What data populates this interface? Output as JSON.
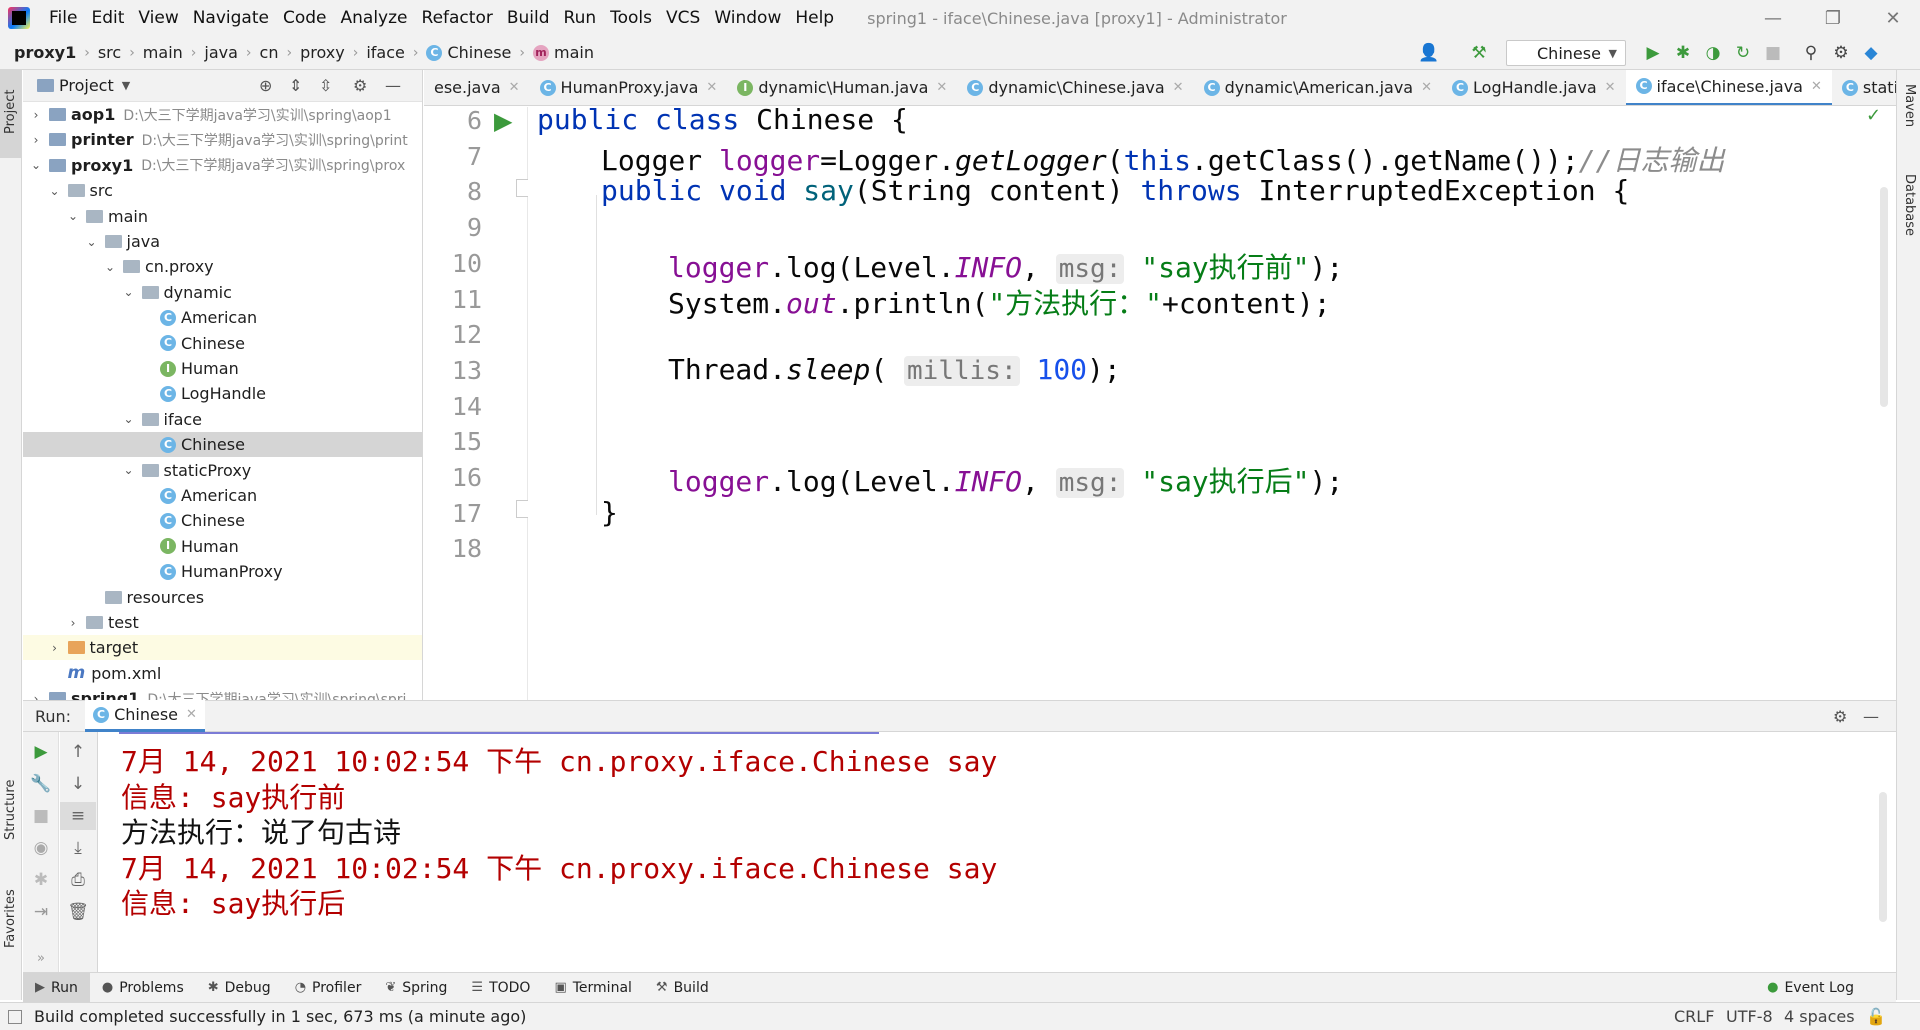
{
  "menu": {
    "items": [
      "File",
      "Edit",
      "View",
      "Navigate",
      "Code",
      "Analyze",
      "Refactor",
      "Build",
      "Run",
      "Tools",
      "VCS",
      "Window",
      "Help"
    ],
    "window_title": "spring1 - iface\\Chinese.java [proxy1] - Administrator"
  },
  "breadcrumb": [
    "proxy1",
    "src",
    "main",
    "java",
    "cn",
    "proxy",
    "iface",
    "Chinese",
    "main"
  ],
  "run_config": "Chinese",
  "project_panel": {
    "title": "Project",
    "tree": [
      {
        "label": "aop1",
        "path": "D:\\大三下学期java学习\\实训\\spring\\aop1",
        "level": 0,
        "bold": true,
        "arrow": "›",
        "icon": "module"
      },
      {
        "label": "printer",
        "path": "D:\\大三下学期java学习\\实训\\spring\\print",
        "level": 0,
        "bold": true,
        "arrow": "›",
        "icon": "module"
      },
      {
        "label": "proxy1",
        "path": "D:\\大三下学期java学习\\实训\\spring\\prox",
        "level": 0,
        "bold": true,
        "arrow": "⌄",
        "icon": "module"
      },
      {
        "label": "src",
        "path": "",
        "level": 1,
        "bold": false,
        "arrow": "⌄",
        "icon": "folder"
      },
      {
        "label": "main",
        "path": "",
        "level": 2,
        "bold": false,
        "arrow": "⌄",
        "icon": "folder"
      },
      {
        "label": "java",
        "path": "",
        "level": 3,
        "bold": false,
        "arrow": "⌄",
        "icon": "folder"
      },
      {
        "label": "cn.proxy",
        "path": "",
        "level": 4,
        "bold": false,
        "arrow": "⌄",
        "icon": "folder"
      },
      {
        "label": "dynamic",
        "path": "",
        "level": 5,
        "bold": false,
        "arrow": "⌄",
        "icon": "folder"
      },
      {
        "label": "American",
        "path": "",
        "level": 6,
        "bold": false,
        "arrow": "",
        "icon": "class"
      },
      {
        "label": "Chinese",
        "path": "",
        "level": 6,
        "bold": false,
        "arrow": "",
        "icon": "class"
      },
      {
        "label": "Human",
        "path": "",
        "level": 6,
        "bold": false,
        "arrow": "",
        "icon": "interface"
      },
      {
        "label": "LogHandle",
        "path": "",
        "level": 6,
        "bold": false,
        "arrow": "",
        "icon": "class"
      },
      {
        "label": "iface",
        "path": "",
        "level": 5,
        "bold": false,
        "arrow": "⌄",
        "icon": "folder"
      },
      {
        "label": "Chinese",
        "path": "",
        "level": 6,
        "bold": false,
        "arrow": "",
        "icon": "class",
        "selected": true
      },
      {
        "label": "staticProxy",
        "path": "",
        "level": 5,
        "bold": false,
        "arrow": "⌄",
        "icon": "folder"
      },
      {
        "label": "American",
        "path": "",
        "level": 6,
        "bold": false,
        "arrow": "",
        "icon": "class"
      },
      {
        "label": "Chinese",
        "path": "",
        "level": 6,
        "bold": false,
        "arrow": "",
        "icon": "class"
      },
      {
        "label": "Human",
        "path": "",
        "level": 6,
        "bold": false,
        "arrow": "",
        "icon": "interface"
      },
      {
        "label": "HumanProxy",
        "path": "",
        "level": 6,
        "bold": false,
        "arrow": "",
        "icon": "class"
      },
      {
        "label": "resources",
        "path": "",
        "level": 3,
        "bold": false,
        "arrow": "",
        "icon": "folder"
      },
      {
        "label": "test",
        "path": "",
        "level": 2,
        "bold": false,
        "arrow": "›",
        "icon": "folder"
      },
      {
        "label": "target",
        "path": "",
        "level": 1,
        "bold": false,
        "arrow": "›",
        "icon": "folder-orange"
      },
      {
        "label": "pom.xml",
        "path": "",
        "level": 1,
        "bold": false,
        "arrow": "",
        "icon": "maven"
      },
      {
        "label": "spring1",
        "path": "D:\\大三下学期java学习\\实训\\spring\\spri",
        "level": 0,
        "bold": true,
        "arrow": "›",
        "icon": "module"
      }
    ]
  },
  "tabs": [
    {
      "label": "ese.java",
      "icon": "none"
    },
    {
      "label": "HumanProxy.java",
      "icon": "class"
    },
    {
      "label": "dynamic\\Human.java",
      "icon": "interface"
    },
    {
      "label": "dynamic\\Chinese.java",
      "icon": "class"
    },
    {
      "label": "dynamic\\American.java",
      "icon": "class"
    },
    {
      "label": "LogHandle.java",
      "icon": "class"
    },
    {
      "label": "iface\\Chinese.java",
      "icon": "class",
      "active": true
    },
    {
      "label": "staticProxy\\A",
      "icon": "class"
    }
  ],
  "editor": {
    "line_numbers": [
      "6",
      "7",
      "8",
      "9",
      "10",
      "11",
      "12",
      "13",
      "14",
      "15",
      "16",
      "17",
      "18"
    ],
    "code": {
      "l6_kw": "public class",
      "l6_rest": " Chinese {",
      "l7_a": "Logger ",
      "l7_field": "logger",
      "l7_b": "=Logger.",
      "l7_method": "getLogger",
      "l7_c": "(",
      "l7_this": "this",
      "l7_d": ".getClass().getName());",
      "l7_comment": "//日志输出",
      "l8_kw": "public void ",
      "l8_name": "say",
      "l8_a": "(String content) ",
      "l8_throws": "throws",
      "l8_b": " InterruptedException {",
      "l10_a": "logger",
      "l10_b": ".log(Level.",
      "l10_info": "INFO",
      "l10_c": ", ",
      "l10_hint": "msg:",
      "l10_str": "\"say执行前\"",
      "l10_d": ");",
      "l11_a": "System.",
      "l11_out": "out",
      "l11_b": ".println(",
      "l11_str": "\"方法执行：\"",
      "l11_c": "+content);",
      "l13_a": "Thread.",
      "l13_sleep": "sleep",
      "l13_b": "( ",
      "l13_hint": "millis:",
      "l13_num": "100",
      "l13_c": ");",
      "l16_a": "logger",
      "l16_b": ".log(Level.",
      "l16_info": "INFO",
      "l16_c": ", ",
      "l16_hint": "msg:",
      "l16_str": "\"say执行后\"",
      "l16_d": ");",
      "l17": "}"
    }
  },
  "run_panel": {
    "label": "Run:",
    "tab": "Chinese",
    "output": [
      {
        "text": "7月 14, 2021 10:02:54 下午 cn.proxy.iface.Chinese say",
        "type": "err"
      },
      {
        "text": "信息: say执行前",
        "type": "err"
      },
      {
        "text": "方法执行：说了句古诗",
        "type": "out"
      },
      {
        "text": "7月 14, 2021 10:02:54 下午 cn.proxy.iface.Chinese say",
        "type": "err"
      },
      {
        "text": "信息: say执行后",
        "type": "err"
      }
    ]
  },
  "tool_windows": [
    "Run",
    "Problems",
    "Debug",
    "Profiler",
    "Spring",
    "TODO",
    "Terminal",
    "Build"
  ],
  "event_log": "Event Log",
  "side_labels": {
    "project": "Project",
    "structure": "Structure",
    "favorites": "Favorites",
    "maven": "Maven",
    "database": "Database"
  },
  "status": {
    "message": "Build completed successfully in 1 sec, 673 ms (a minute ago)",
    "line_sep": "CRLF",
    "encoding": "UTF-8",
    "indent": "4 spaces"
  }
}
